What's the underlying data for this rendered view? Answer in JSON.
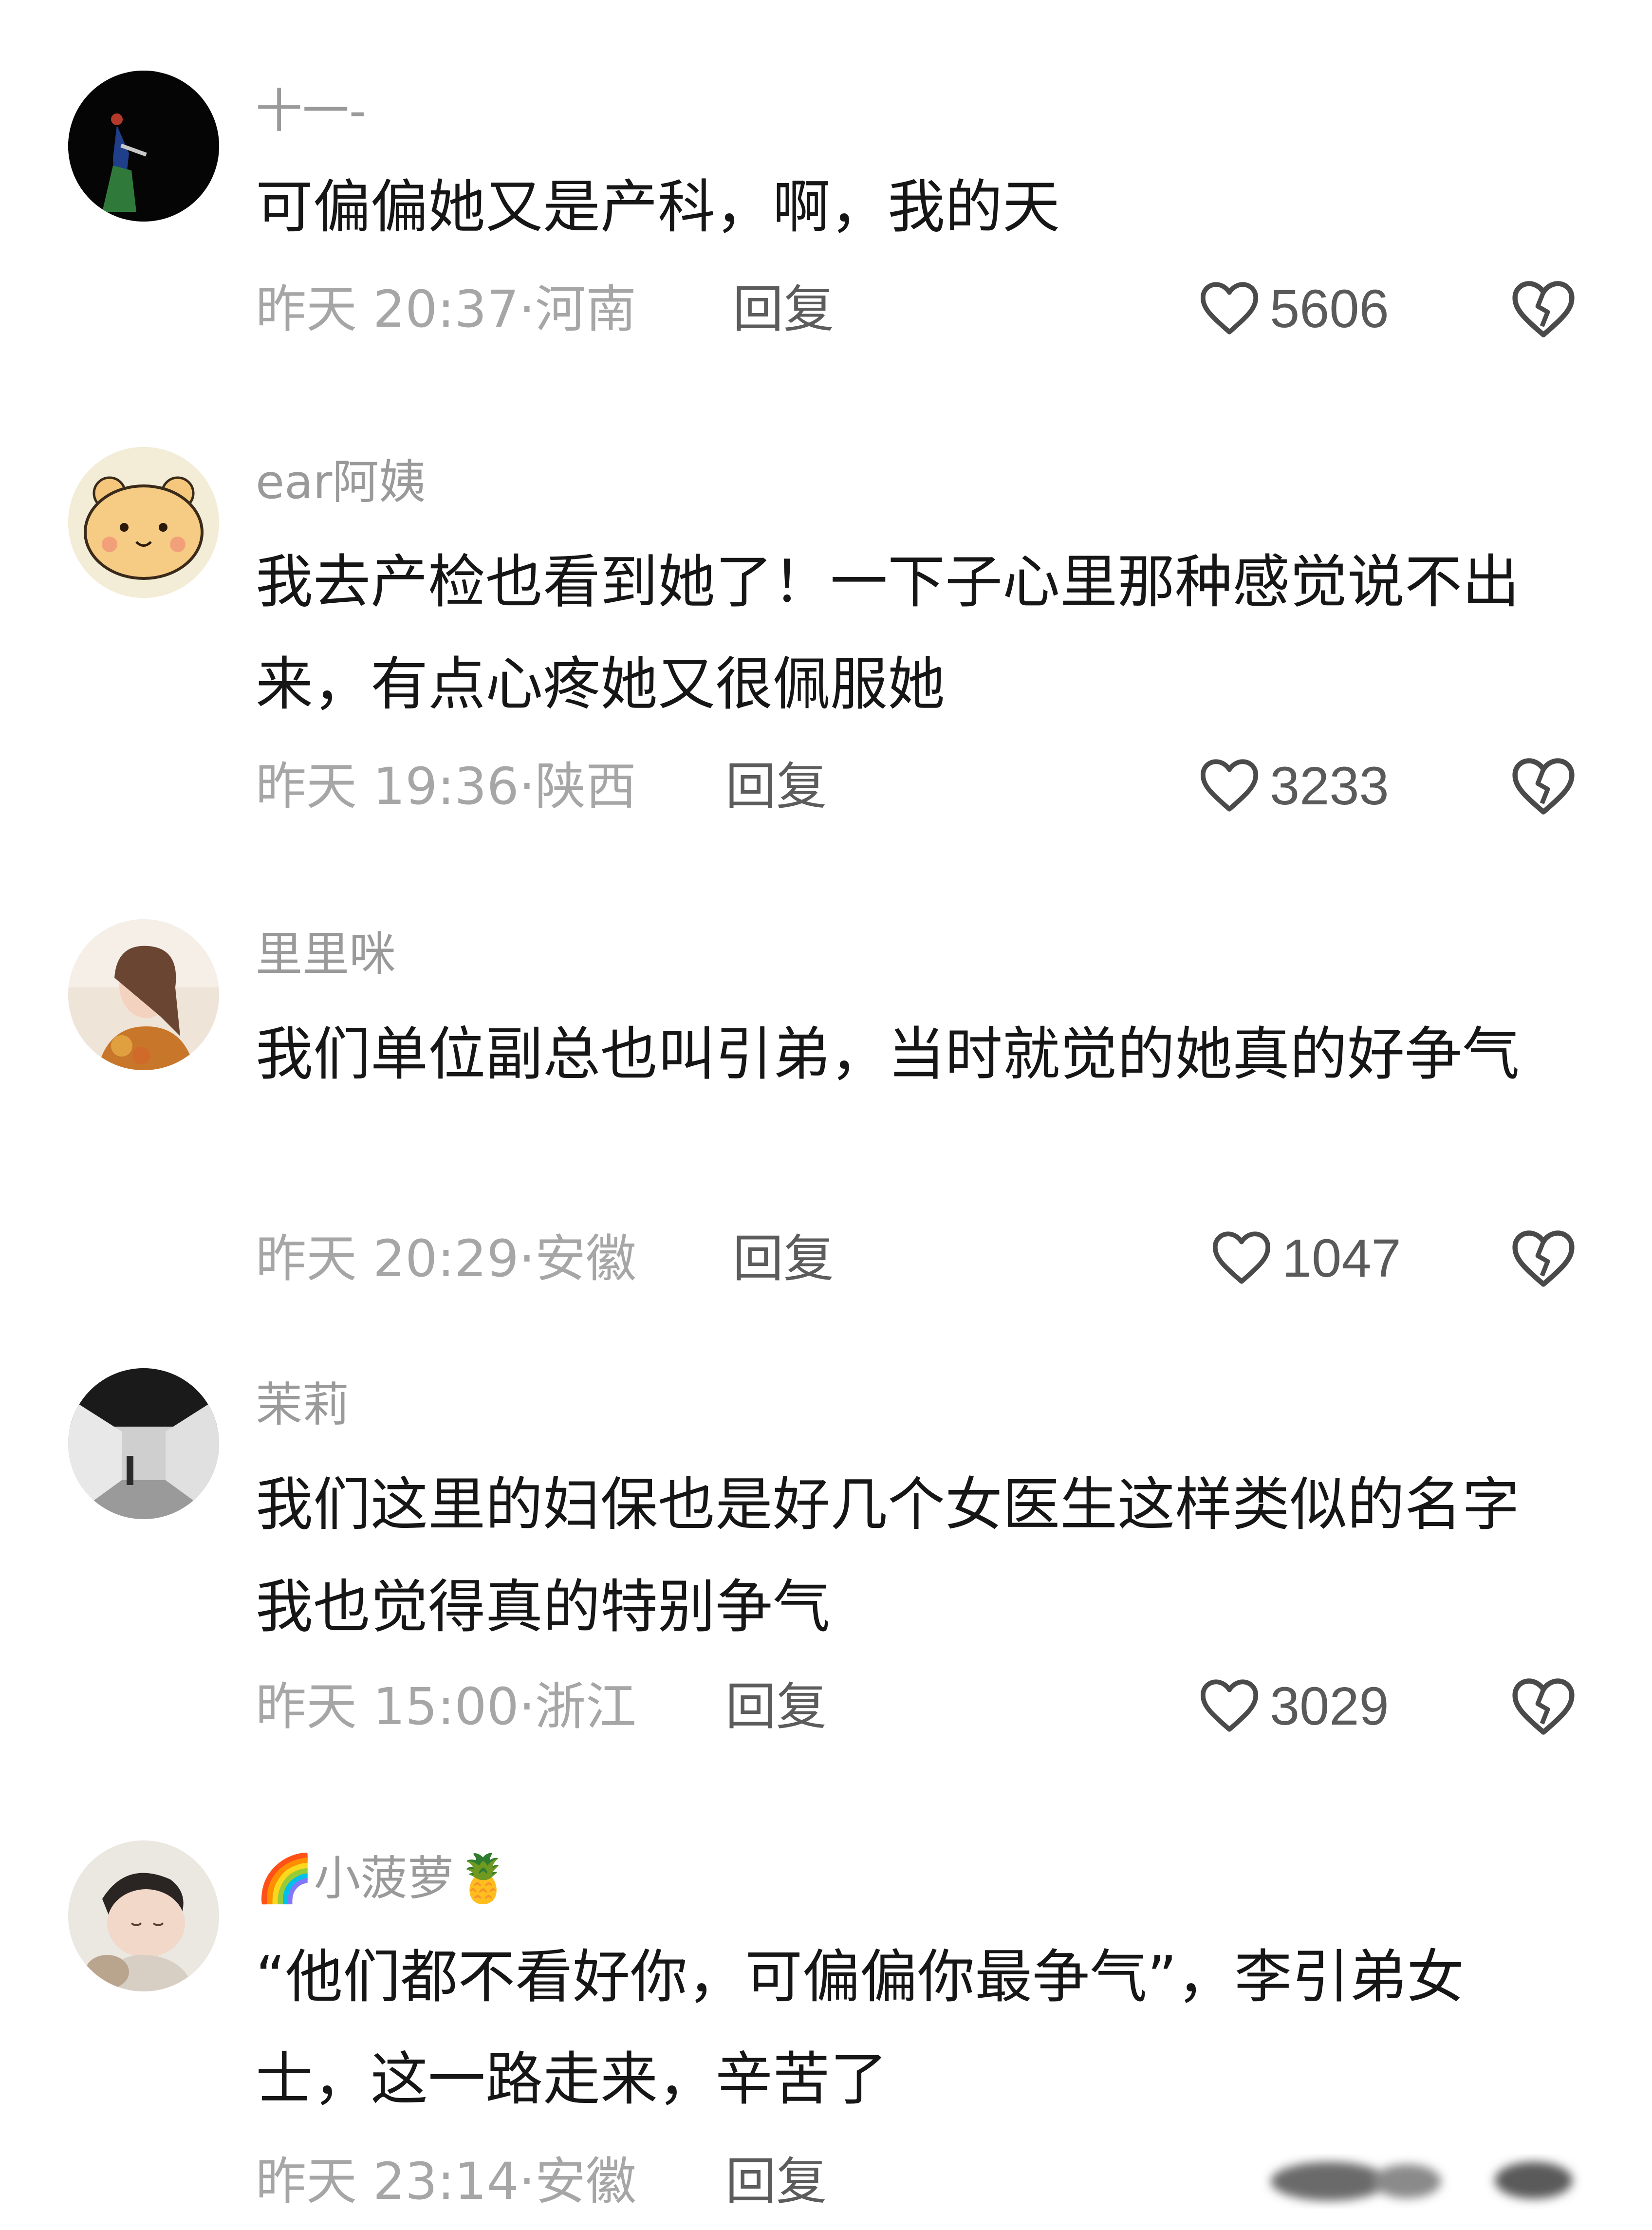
{
  "comments": [
    {
      "username": "十一-",
      "content": "可偏偏她又是产科，啊，我的天",
      "time": "昨天 20:37",
      "location": "河南",
      "reply_label": "回复",
      "likes": "5606"
    },
    {
      "username": "ear阿姨",
      "content": "我去产检也看到她了！一下子心里那种感觉说不出来，有点心疼她又很佩服她",
      "time": "昨天 19:36",
      "location": "陕西",
      "reply_label": "回复",
      "likes": "3233"
    },
    {
      "username": "里里咪",
      "content": "我们单位副总也叫引弟，当时就觉的她真的好争气",
      "time": "昨天 20:29",
      "location": "安徽",
      "reply_label": "回复",
      "likes": "1047"
    },
    {
      "username": "茉莉",
      "content": "我们这里的妇保也是好几个女医生这样类似的名字 我也觉得真的特别争气",
      "time": "昨天 15:00",
      "location": "浙江",
      "reply_label": "回复",
      "likes": "3029"
    },
    {
      "username_prefix_emoji": "🌈",
      "username": "小菠萝",
      "username_suffix_emoji": "🍍",
      "content": "“他们都不看好你，可偏偏你最争气”，李引弟女士，这一路走来，辛苦了",
      "time": "昨天 23:14",
      "location": "安徽",
      "reply_label": "回复"
    }
  ],
  "meta_separator": "·",
  "icons": {
    "like": "heart-outline-icon",
    "dislike": "broken-heart-icon"
  },
  "colors": {
    "username": "#9a9a9a",
    "content": "#161616",
    "meta": "#a6a6a6",
    "reply": "#5c5c5c",
    "icon": "#4a4a4a"
  }
}
